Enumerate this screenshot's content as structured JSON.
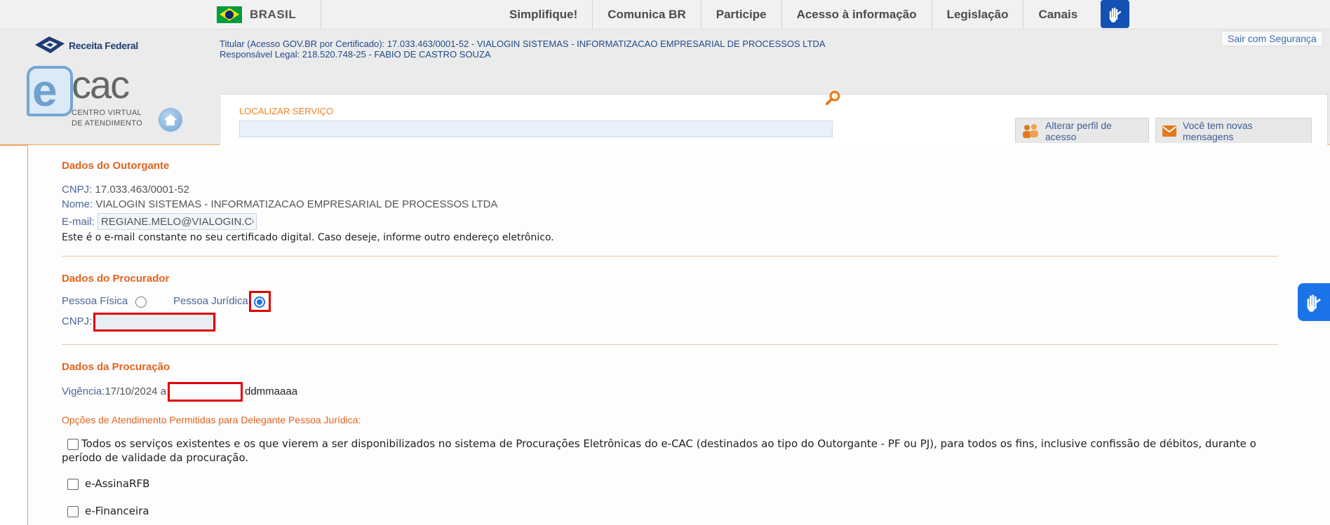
{
  "govbar": {
    "country": "BRASIL",
    "nav": [
      "Simplifique!",
      "Comunica BR",
      "Participe",
      "Acesso à informação",
      "Legislação",
      "Canais"
    ]
  },
  "header": {
    "receita_logo": "Receita Federal",
    "ecac_e": "e",
    "ecac_cac": "cac",
    "ecac_sub_1": "Centro Virtual",
    "ecac_sub_2": "de Atendimento",
    "titular": "Titular (Acesso GOV.BR por Certificado): 17.033.463/0001-52 - VIALOGIN SISTEMAS - INFORMATIZACAO EMPRESARIAL DE PROCESSOS LTDA",
    "responsavel": "Responsável Legal: 218.520.748-25 - FABIO DE CASTRO SOUZA",
    "logout": "Sair com Segurança",
    "search_label": "LOCALIZAR SERVIÇO",
    "search_value": "",
    "profile_button": "Alterar perfil de acesso",
    "messages_button": "Você tem novas mensagens"
  },
  "outorgante": {
    "title": "Dados do Outorgante",
    "cnpj_label": "CNPJ:",
    "cnpj": "17.033.463/0001-52",
    "nome_label": "Nome:",
    "nome": "VIALOGIN SISTEMAS - INFORMATIZACAO EMPRESARIAL DE PROCESSOS LTDA",
    "email_label": "E-mail:",
    "email": "REGIANE.MELO@VIALOGIN.COM.BR",
    "note": "Este é o e-mail constante no seu certificado digital. Caso deseje, informe outro endereço eletrônico."
  },
  "procurador": {
    "title": "Dados do Procurador",
    "pf_label": "Pessoa Física",
    "pj_label": "Pessoa Jurídica",
    "selected": "Pessoa Jurídica",
    "cnpj_label": "CNPJ:",
    "cnpj": ""
  },
  "procuracao": {
    "title": "Dados da Procuração",
    "vigencia_label": "Vigência:",
    "start_date": "17/10/2024",
    "sep": "a",
    "end_date": "",
    "date_hint": "ddmmaaaa",
    "opcoes_label": "Opções de Atendimento Permitidas para Delegante Pessoa Jurídica:",
    "options": [
      "Todos os serviços existentes e os que vierem a ser disponibilizados no sistema de Procurações Eletrônicas do e-CAC (destinados ao tipo do Outorgante - PF ou PJ), para todos os fins, inclusive confissão de débitos, durante o período de validade da procuração.",
      "e-AssinaRFB",
      "e-Financeira"
    ]
  },
  "colors": {
    "accent_orange": "#e2641f",
    "link_blue": "#4a6797",
    "highlight_red": "#e00000",
    "govbr_blue": "#1351b4"
  }
}
